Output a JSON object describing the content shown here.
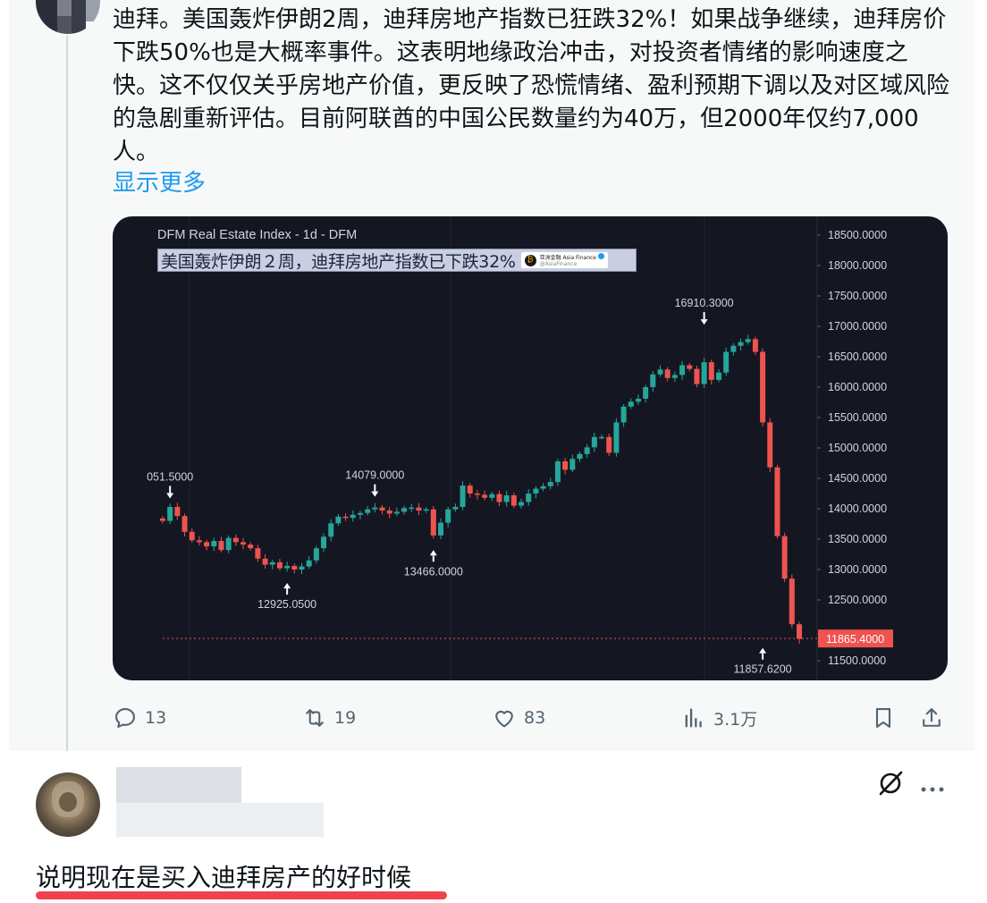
{
  "post": {
    "text": "迪拜。美国轰炸伊朗2周，迪拜房地产指数已狂跌32%！如果战争继续，迪拜房价下跌50%也是大概率事件。这表明地缘政治冲击，对投资者情绪的影响速度之快。这不仅仅关乎房地产价值，更反映了恐慌情绪、盈利预期下调以及对区域风险的急剧重新评估。目前阿联酋的中国公民数量约为40万，但2000年仅约7,000人。",
    "show_more": "显示更多"
  },
  "chart_card": {
    "title": "DFM Real Estate Index - 1d - DFM",
    "banner": "美国轰炸伊朗２周，迪拜房地产指数已下跌32%",
    "brand_name": "亚洲金融 Asia Finance",
    "brand_handle": "@AsiaFinance"
  },
  "chart_data": {
    "type": "candlestick",
    "title": "DFM Real Estate Index - 1d - DFM",
    "ylim": [
      11400,
      18600
    ],
    "y_ticks": [
      "18500.0000",
      "18000.0000",
      "17500.0000",
      "17000.0000",
      "16500.0000",
      "16000.0000",
      "15500.0000",
      "15000.0000",
      "14500.0000",
      "14000.0000",
      "13500.0000",
      "13000.0000",
      "12500.0000",
      "11500.0000"
    ],
    "current_price": "11865.4000",
    "annotations": [
      {
        "label": "051.5000",
        "value": 14051.5,
        "index": 1,
        "type": "high"
      },
      {
        "label": "12925.0500",
        "value": 12925.05,
        "index": 17,
        "type": "low"
      },
      {
        "label": "14079.0000",
        "value": 14079.0,
        "index": 29,
        "type": "high"
      },
      {
        "label": "13466.0000",
        "value": 13466.0,
        "index": 37,
        "type": "low"
      },
      {
        "label": "16910.3000",
        "value": 16910.3,
        "index": 74,
        "type": "high"
      },
      {
        "label": "11857.6200",
        "value": 11857.62,
        "index": 82,
        "type": "low"
      }
    ],
    "closes": [
      13800,
      14030,
      13880,
      13620,
      13480,
      13450,
      13380,
      13470,
      13320,
      13520,
      13450,
      13410,
      13350,
      13180,
      13080,
      13120,
      13020,
      13060,
      13000,
      13050,
      13150,
      13350,
      13540,
      13760,
      13870,
      13850,
      13900,
      13930,
      13990,
      14020,
      13970,
      13920,
      13950,
      14010,
      14020,
      13970,
      13990,
      13560,
      13770,
      13990,
      14030,
      14380,
      14250,
      14230,
      14180,
      14240,
      14110,
      14220,
      14050,
      14110,
      14250,
      14330,
      14370,
      14440,
      14780,
      14640,
      14820,
      14900,
      15010,
      15180,
      15180,
      14920,
      15420,
      15680,
      15760,
      15810,
      16000,
      16210,
      16290,
      16150,
      16200,
      16360,
      16300,
      16050,
      16410,
      16120,
      16240,
      16580,
      16680,
      16740,
      16790,
      16580,
      15420,
      14680,
      13550,
      12850,
      12100,
      11860
    ],
    "y_label": "",
    "x_label": ""
  },
  "actions": {
    "reply_count": "13",
    "retweet_count": "19",
    "like_count": "83",
    "view_count": "3.1万"
  },
  "reply": {
    "text": "说明现在是买入迪拜房产的好时候"
  },
  "colors": {
    "up": "#26a69a",
    "down": "#ef5350",
    "link": "#1d9bf0",
    "highlight": "#f0424c"
  }
}
